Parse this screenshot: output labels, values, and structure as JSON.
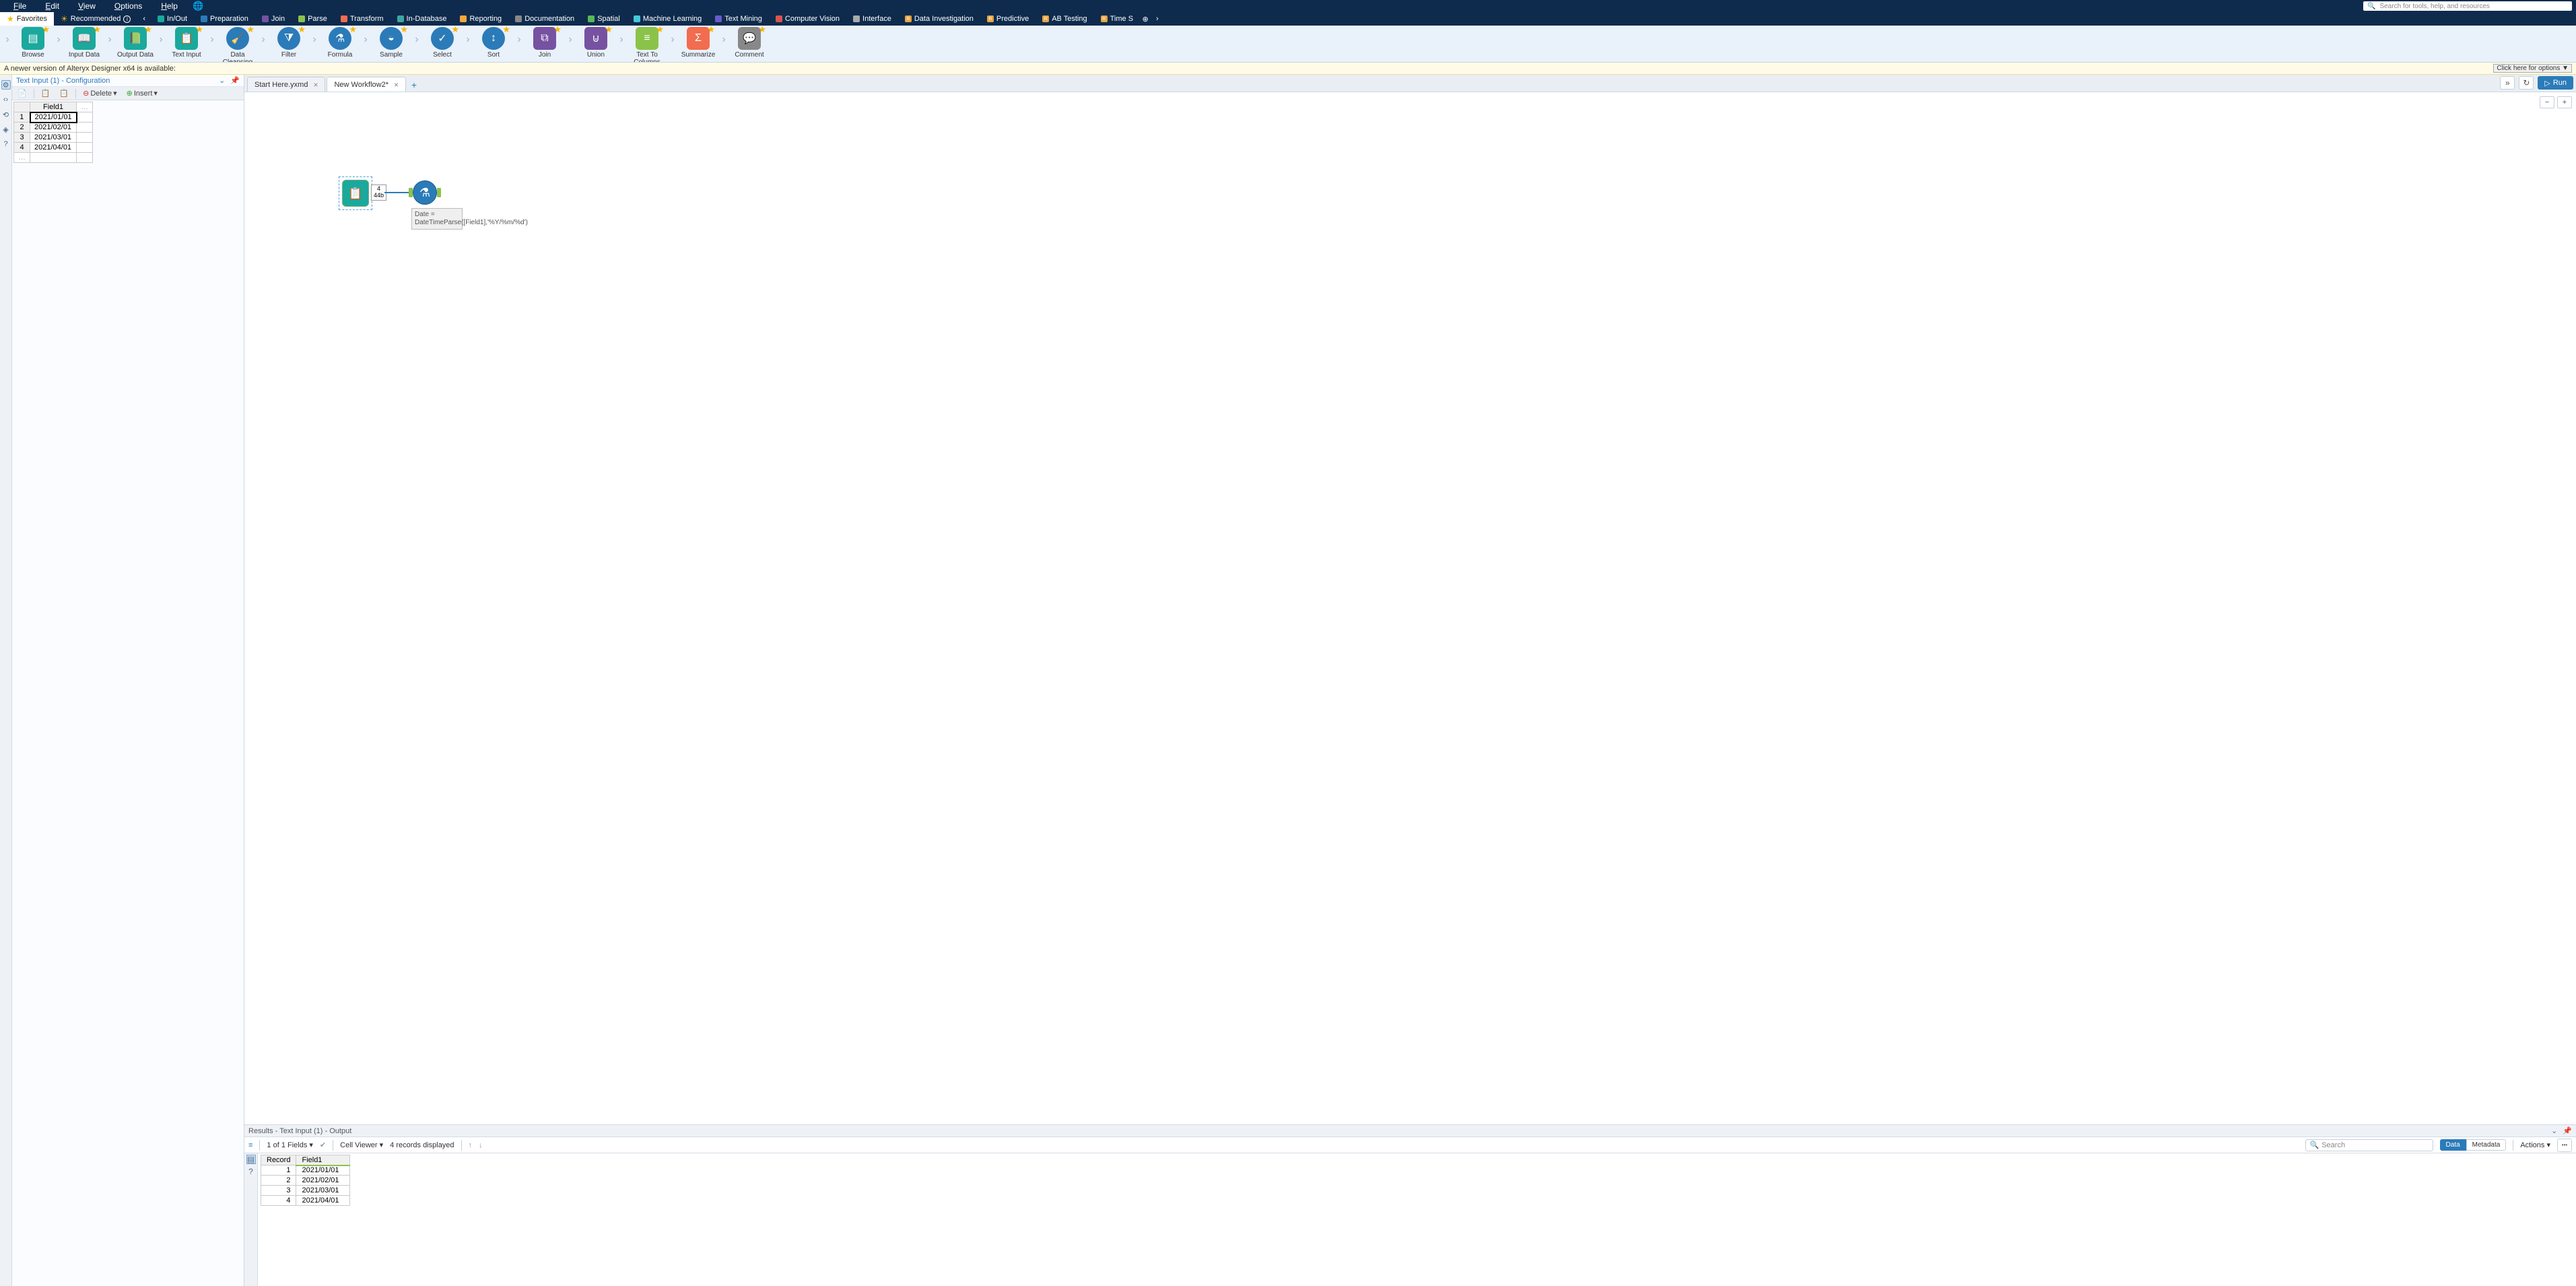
{
  "menu": {
    "file": "File",
    "edit": "Edit",
    "view": "View",
    "options": "Options",
    "help": "Help"
  },
  "search_placeholder": "Search for tools, help, and resources",
  "categories": {
    "favorites": "Favorites",
    "recommended": "Recommended",
    "items": [
      {
        "label": "In/Out",
        "color": "#1aa99c"
      },
      {
        "label": "Preparation",
        "color": "#2b7bb9"
      },
      {
        "label": "Join",
        "color": "#7652a1"
      },
      {
        "label": "Parse",
        "color": "#8bc34a"
      },
      {
        "label": "Transform",
        "color": "#f26c4f"
      },
      {
        "label": "In-Database",
        "color": "#3fa6a0"
      },
      {
        "label": "Reporting",
        "color": "#f2a83b"
      },
      {
        "label": "Documentation",
        "color": "#888888"
      },
      {
        "label": "Spatial",
        "color": "#57b957"
      },
      {
        "label": "Machine Learning",
        "color": "#45c7d9"
      },
      {
        "label": "Text Mining",
        "color": "#6a5acd"
      },
      {
        "label": "Computer Vision",
        "color": "#d9534f"
      },
      {
        "label": "Interface",
        "color": "#aaaaaa"
      },
      {
        "label": "Data Investigation",
        "color": "#e8a33d"
      },
      {
        "label": "Predictive",
        "color": "#e8a33d"
      },
      {
        "label": "AB Testing",
        "color": "#e8a33d"
      },
      {
        "label": "Time S",
        "color": "#e8a33d"
      }
    ]
  },
  "tools": [
    {
      "label": "Browse",
      "shape": "sq",
      "color": "#1aa99c",
      "glyph": "▤"
    },
    {
      "label": "Input Data",
      "shape": "sq",
      "color": "#1aa99c",
      "glyph": "📖"
    },
    {
      "label": "Output Data",
      "shape": "sq",
      "color": "#1aa99c",
      "glyph": "📗"
    },
    {
      "label": "Text Input",
      "shape": "sq",
      "color": "#1aa99c",
      "glyph": "📋"
    },
    {
      "label": "Data Cleansing",
      "shape": "rd",
      "color": "#2b7bb9",
      "glyph": "🧹"
    },
    {
      "label": "Filter",
      "shape": "rd",
      "color": "#2b7bb9",
      "glyph": "⧩"
    },
    {
      "label": "Formula",
      "shape": "rd",
      "color": "#2b7bb9",
      "glyph": "⚗"
    },
    {
      "label": "Sample",
      "shape": "rd",
      "color": "#2b7bb9",
      "glyph": "◒"
    },
    {
      "label": "Select",
      "shape": "rd",
      "color": "#2b7bb9",
      "glyph": "✓"
    },
    {
      "label": "Sort",
      "shape": "rd",
      "color": "#2b7bb9",
      "glyph": "↕"
    },
    {
      "label": "Join",
      "shape": "sq",
      "color": "#7652a1",
      "glyph": "⧉"
    },
    {
      "label": "Union",
      "shape": "sq",
      "color": "#7652a1",
      "glyph": "⊍"
    },
    {
      "label": "Text To Columns",
      "shape": "sq",
      "color": "#8bc34a",
      "glyph": "≡"
    },
    {
      "label": "Summarize",
      "shape": "sq",
      "color": "#f26c4f",
      "glyph": "Σ"
    },
    {
      "label": "Comment",
      "shape": "sq",
      "color": "#888888",
      "glyph": "💬"
    }
  ],
  "notification": {
    "text": "A newer version of Alteryx Designer x64 is available:",
    "button": "Click here for options ▼"
  },
  "config": {
    "title": "Text Input (1) - Configuration",
    "delete": "Delete",
    "insert": "Insert",
    "header": "Field1",
    "rows": [
      "2021/01/01",
      "2021/02/01",
      "2021/03/01",
      "2021/04/01"
    ]
  },
  "tabs": {
    "t1": "Start Here.yxmd",
    "t2": "New Workflow2*"
  },
  "run": "Run",
  "canvas": {
    "meta_count": "4",
    "meta_size": "44b",
    "annotation": "Date = DateTimeParse([Field1],'%Y/%m/%d')"
  },
  "results": {
    "title": "Results - Text Input (1) - Output",
    "fields_label": "1 of 1 Fields",
    "cell_viewer": "Cell Viewer",
    "records_label": "4 records displayed",
    "search_placeholder": "Search",
    "data": "Data",
    "metadata": "Metadata",
    "actions": "Actions",
    "col_record": "Record",
    "col_field1": "Field1",
    "rows": [
      {
        "n": "1",
        "v": "2021/01/01"
      },
      {
        "n": "2",
        "v": "2021/02/01"
      },
      {
        "n": "3",
        "v": "2021/03/01"
      },
      {
        "n": "4",
        "v": "2021/04/01"
      }
    ]
  }
}
